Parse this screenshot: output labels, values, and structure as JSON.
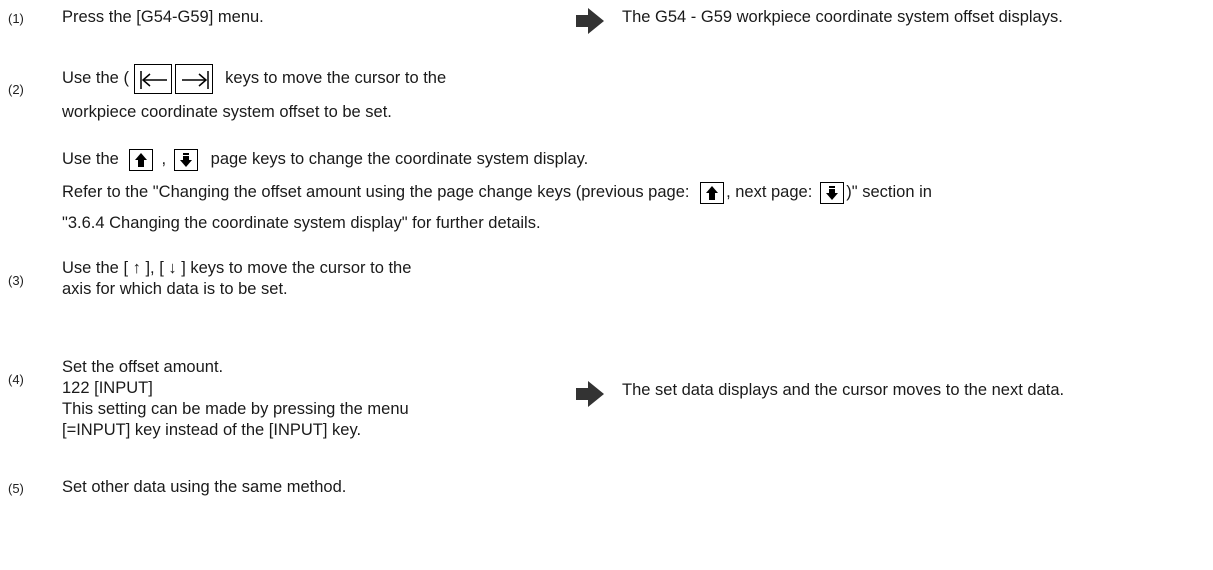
{
  "steps": [
    {
      "number": "(1)",
      "text": "Press the [G54-G59] menu.",
      "result": "The G54 - G59 workpiece coordinate system offset displays."
    },
    {
      "number": "(2)",
      "text_a": "Use the (",
      "text_b": "keys to move the cursor to the",
      "line2": "workpiece coordinate system offset to be set.",
      "page_keys": {
        "prefix": "Use the",
        "comma": ",",
        "suffix": "page keys to change the coordinate system display."
      },
      "refer": {
        "prefix": "Refer to the \"Changing the offset amount using the page change keys (previous page:",
        "middle": ", next page:",
        "suffix": ")\" section in",
        "line2": "\"3.6.4 Changing the coordinate system display\" for further details."
      }
    },
    {
      "number": "(3)",
      "lines": [
        "Use the [ ↑ ], [ ↓ ] keys to move the cursor to the",
        "axis for which data is to be set."
      ]
    },
    {
      "number": "(4)",
      "lines": [
        "Set the offset amount.",
        "122 [INPUT]",
        "This setting can be made by pressing the menu",
        "[=INPUT] key instead of the [INPUT] key."
      ],
      "result": "The set data displays and the cursor moves to the next data."
    },
    {
      "number": "(5)",
      "text": "Set other data using the same method."
    }
  ],
  "icons": {
    "result_arrow": "right-arrow-icon",
    "tab_left": "tab-left-key-icon",
    "tab_right": "tab-right-key-icon",
    "page_up": "page-up-key-icon",
    "page_down": "page-down-key-icon"
  },
  "colors": {
    "arrow": "#333333",
    "text": "#1a1a1a"
  }
}
